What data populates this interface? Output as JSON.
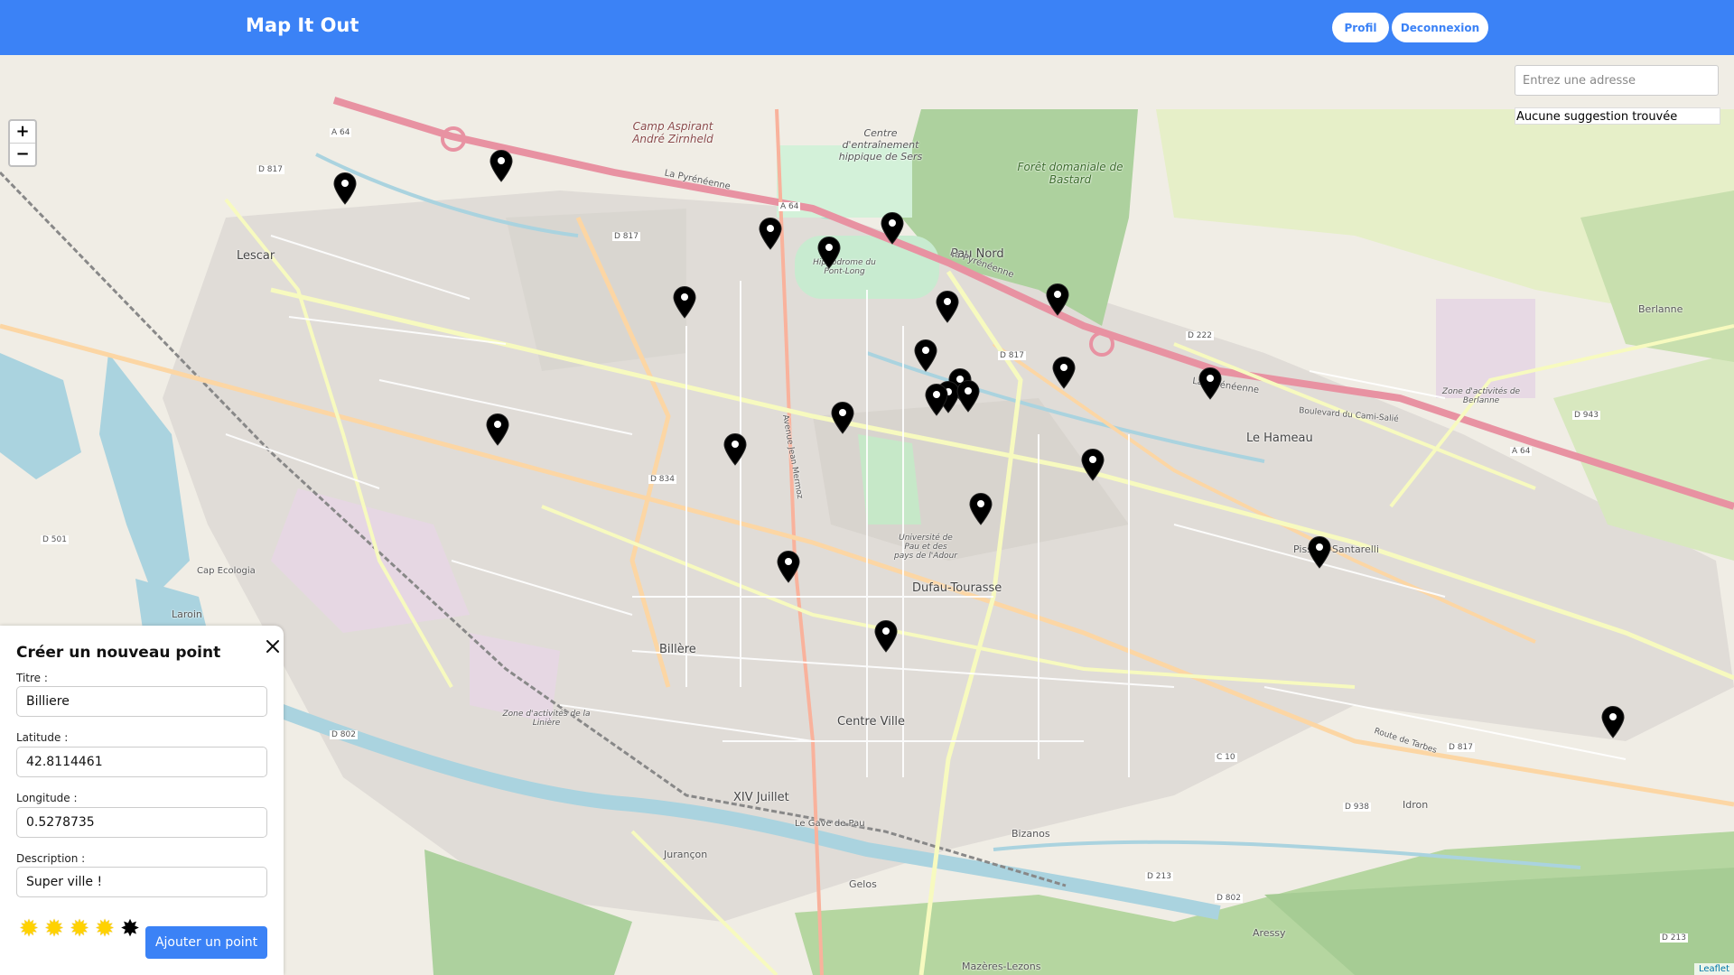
{
  "app": {
    "title": "Map It Out"
  },
  "nav": {
    "profile_label": "Profil",
    "logout_label": "Deconnexion"
  },
  "map": {
    "zoom_in": "+",
    "zoom_out": "−",
    "search_placeholder": "Entrez une adresse",
    "suggestion_text": "Aucune suggestion trouvée",
    "attribution": "Leaflet",
    "labels": {
      "lescar": "Lescar",
      "billere": "Billère",
      "centre_ville": "Centre Ville",
      "dufau": "Dufau-Tourasse",
      "le_hameau": "Le Hameau",
      "pau_nord": "Pau Nord",
      "pissard": "Pissard-Santarelli",
      "xiv_juillet": "XIV Juillet",
      "jurancon": "Jurançon",
      "gelos": "Gelos",
      "bizanos": "Bizanos",
      "idron": "Idron",
      "aressy": "Aressy",
      "mazeres": "Mazères-Lezons",
      "berlanne": "Berlanne",
      "laroin": "Laroin",
      "foret": "Forêt domaniale de Bastard",
      "camp": "Camp Aspirant André Zirnheld",
      "hippique": "Centre d'entraînement hippique de Sers",
      "hippodrome": "Hippodrome du Pont-Long",
      "universite": "Université de Pau et des pays de l'Adour",
      "la_pyreneenne": "La Pyrénéenne",
      "a64": "A 64",
      "d817": "D 817",
      "d834": "D 834",
      "d802": "D 802",
      "d938": "D 938",
      "d943": "D 943",
      "d222": "D 222",
      "d213": "D 213",
      "d501": "D 501",
      "c10": "C 10",
      "avenue_jean_mermoz": "Avenue Jean Mermoz",
      "route_de_tarbes": "Route de Tarbes",
      "boulevard_cami_salie": "Boulevard du Cami-Salié",
      "gave_de_pau": "Le Gave de Pau",
      "zone_liniere": "Zone d'activités de la Linière",
      "zone_berlanne": "Zone d'activités de Berlanne",
      "cap_ecologia": "Cap Ecologia"
    }
  },
  "panel": {
    "title": "Créer un nouveau point",
    "title_label": "Titre :",
    "title_value": "Billiere",
    "lat_label": "Latitude :",
    "lat_value": "42.8114461",
    "lng_label": "Longitude :",
    "lng_value": "0.5278735",
    "desc_label": "Description :",
    "desc_value": "Super ville !",
    "rating": 4,
    "rating_max": 5,
    "submit_label": "Ajouter un point"
  },
  "colors": {
    "navbar": "#3b82f6",
    "motorway": "#e892a2",
    "primary_road": "#fcd6a4",
    "secondary_road": "#f7fabf",
    "forest": "#add19e",
    "water": "#aad3df",
    "marker": "#000000"
  }
}
